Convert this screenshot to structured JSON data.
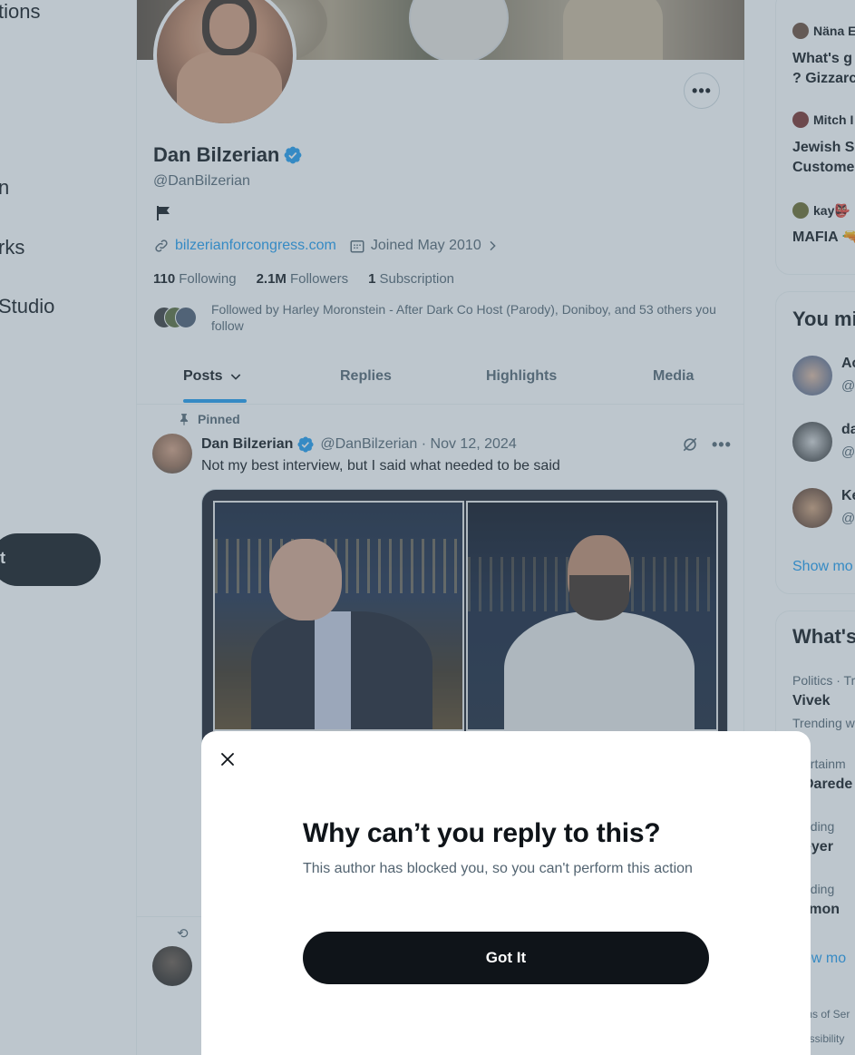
{
  "nav": {
    "items": [
      {
        "label": "tions"
      },
      {
        "label": "n"
      },
      {
        "label": "rks"
      },
      {
        "label": "Studio"
      }
    ],
    "post_label": "t"
  },
  "profile": {
    "name": "Dan Bilzerian",
    "handle": "@DanBilzerian",
    "website": "bilzerianforcongress.com",
    "joined": "Joined May 2010",
    "following_count": "110",
    "following_label": "Following",
    "followers_count": "2.1M",
    "followers_label": "Followers",
    "subscription_count": "1",
    "subscription_label": "Subscription",
    "followed_by": "Followed by Harley Moronstein - After Dark Co Host (Parody), Doniboy, and 53 others you follow",
    "verified_color": "#1d9bf0"
  },
  "tabs": [
    {
      "label": "Posts"
    },
    {
      "label": "Replies"
    },
    {
      "label": "Highlights"
    },
    {
      "label": "Media"
    }
  ],
  "post": {
    "pinned_label": "Pinned",
    "author": "Dan Bilzerian",
    "meta": "@DanBilzerian · Nov 12, 2024",
    "text": "Not my best interview, but I said what needed to be said"
  },
  "right": {
    "trends": [
      {
        "user": "Näna E",
        "text": "What's g\n? Gizzarc"
      },
      {
        "user": "Mitch I",
        "text": "Jewish S\nCustome"
      },
      {
        "user": "kay👺",
        "text": "MAFIA 🔫"
      }
    ],
    "who_to_follow": {
      "title": "You mi",
      "accounts": [
        {
          "name": "Ac",
          "handle": "@"
        },
        {
          "name": "da",
          "handle": "@"
        },
        {
          "name": "Ke",
          "handle": "@"
        }
      ],
      "show_more": "Show mo"
    },
    "whats_happening": {
      "title": "What's",
      "items": [
        {
          "sub": "Politics · Tr",
          "topic": "Vivek"
        },
        {
          "sub": "Trending w",
          "topic": ""
        },
        {
          "sub": "ertainm",
          "topic": "Darede"
        },
        {
          "sub": "nding",
          "topic": "eyer"
        },
        {
          "sub": "nding",
          "topic": "rmon"
        }
      ],
      "show_more": "ow mo"
    },
    "footer": [
      "ms of Ser",
      "essibility"
    ]
  },
  "modal": {
    "title": "Why can’t you reply to this?",
    "body": "This author has blocked you, so you can't perform this action",
    "button": "Got It"
  }
}
